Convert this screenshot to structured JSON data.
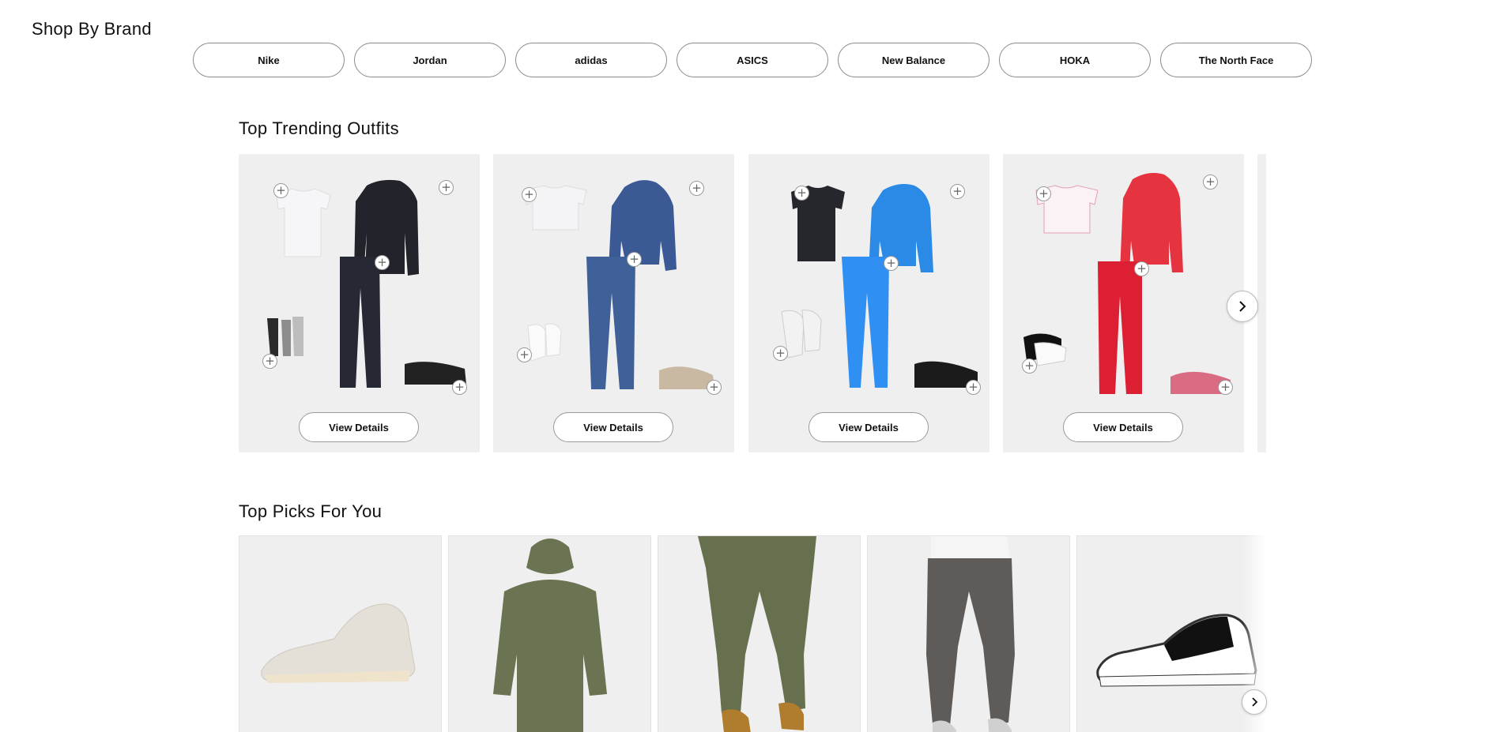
{
  "brands": {
    "title": "Shop By Brand",
    "items": [
      "Nike",
      "Jordan",
      "adidas",
      "ASICS",
      "New Balance",
      "HOKA",
      "The North Face"
    ]
  },
  "trending": {
    "title": "Top Trending Outfits",
    "view_label": "View Details"
  },
  "picks": {
    "title": "Top Picks For You"
  },
  "icons": {
    "add": "plus-icon",
    "next": "chevron-right-icon"
  },
  "colors": {
    "card_bg": "#efefef",
    "pill_border": "#8a8a8a"
  }
}
